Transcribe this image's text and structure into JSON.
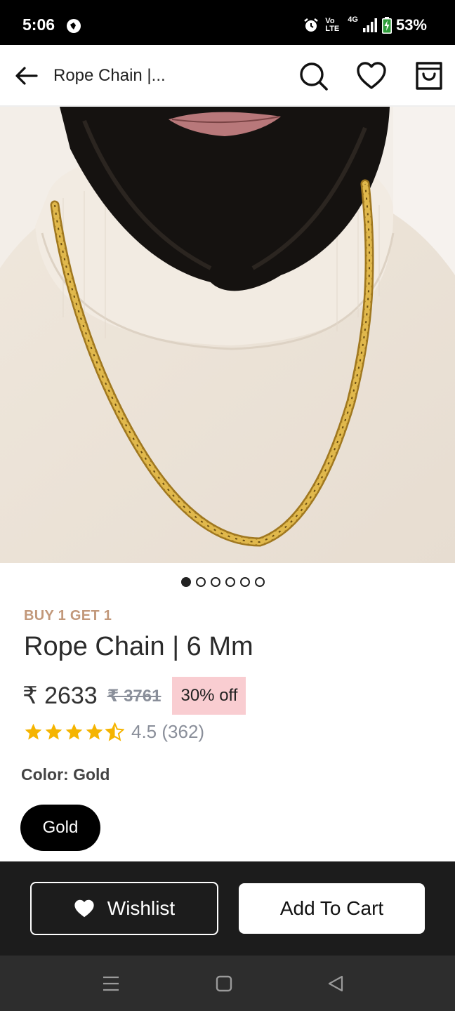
{
  "status_bar": {
    "time": "5:06",
    "network_type": "4G",
    "volte_label_top": "Vo",
    "volte_label_bottom": "LTE",
    "battery": "53%"
  },
  "header": {
    "title": "Rope Chain |...",
    "icons": [
      "back-arrow-icon",
      "search-icon",
      "heart-icon",
      "shopping-bag-icon"
    ]
  },
  "gallery": {
    "image_count": 6,
    "active_index": 0
  },
  "product": {
    "offer_tag": "BUY 1 GET 1",
    "title": "Rope Chain | 6 Mm",
    "price": "₹ 2633",
    "mrp": "₹ 3761",
    "discount": "30% off",
    "rating_stars": 4.5,
    "rating_text": "4.5 (362)",
    "color_label": "Color: Gold",
    "color_option": "Gold"
  },
  "colors": {
    "offer_tag": "#c2987a",
    "discount_bg": "#f9cdd1",
    "star": "#f5b400",
    "bottom_bar": "#1c1c1c"
  },
  "actions": {
    "wishlist_label": "Wishlist",
    "add_to_cart_label": "Add To Cart"
  }
}
